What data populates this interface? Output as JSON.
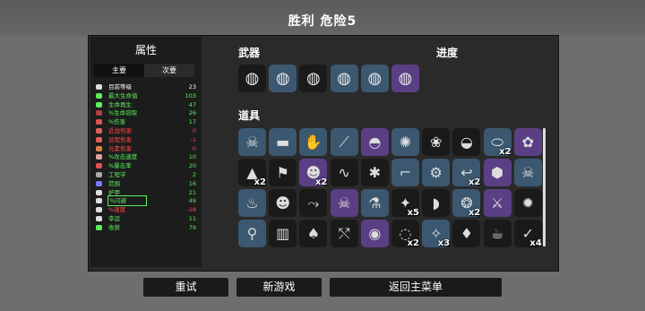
{
  "header": {
    "title": "胜利  危险5"
  },
  "stats_panel": {
    "title": "属性",
    "tabs": [
      {
        "label": "主要"
      },
      {
        "label": "次要"
      }
    ],
    "items": [
      {
        "label": "目前等级",
        "value": "23",
        "label_color": "#ffffff",
        "value_color": "#ffffff",
        "icon": "level-icon",
        "icon_color": "#dddddd"
      },
      {
        "label": "最大生命值",
        "value": "103",
        "label_color": "#5cf05c",
        "value_color": "#5cf05c",
        "icon": "heart-icon",
        "icon_color": "#5cf05c"
      },
      {
        "label": "生命再生",
        "value": "47",
        "label_color": "#5cf05c",
        "value_color": "#5cf05c",
        "icon": "regen-icon",
        "icon_color": "#5cf05c"
      },
      {
        "label": "%生命窃取",
        "value": "26",
        "label_color": "#5cf05c",
        "value_color": "#5cf05c",
        "icon": "lifesteal-icon",
        "icon_color": "#b04040"
      },
      {
        "label": "%伤害",
        "value": "17",
        "label_color": "#5cf05c",
        "value_color": "#5cf05c",
        "icon": "damage-icon",
        "icon_color": "#e05050"
      },
      {
        "label": "近战伤害",
        "value": "0",
        "label_color": "#ff4848",
        "value_color": "#ff4848",
        "icon": "melee-icon",
        "icon_color": "#e06060"
      },
      {
        "label": "远程伤害",
        "value": "-1",
        "label_color": "#ff4848",
        "value_color": "#ff4848",
        "icon": "ranged-icon",
        "icon_color": "#e06060"
      },
      {
        "label": "元素伤害",
        "value": "0",
        "label_color": "#ff4848",
        "value_color": "#ff4848",
        "icon": "elemental-icon",
        "icon_color": "#e08040"
      },
      {
        "label": "%攻击速度",
        "value": "10",
        "label_color": "#5cf05c",
        "value_color": "#5cf05c",
        "icon": "attack-speed-icon",
        "icon_color": "#e0a0a0"
      },
      {
        "label": "%暴击率",
        "value": "20",
        "label_color": "#5cf05c",
        "value_color": "#5cf05c",
        "icon": "crit-icon",
        "icon_color": "#e05050"
      },
      {
        "label": "工程学",
        "value": "2",
        "label_color": "#5cf05c",
        "value_color": "#5cf05c",
        "icon": "engineering-icon",
        "icon_color": "#aaaaaa"
      },
      {
        "label": "范围",
        "value": "16",
        "label_color": "#5cf05c",
        "value_color": "#5cf05c",
        "icon": "range-icon",
        "icon_color": "#7a7aff"
      },
      {
        "label": "护甲",
        "value": "21",
        "label_color": "#5cf05c",
        "value_color": "#5cf05c",
        "icon": "armor-icon",
        "icon_color": "#dddddd"
      },
      {
        "label": "%闪避",
        "value": "49",
        "label_color": "#5cf05c",
        "value_color": "#5cf05c",
        "icon": "dodge-icon",
        "icon_color": "#dddddd",
        "selected": true
      },
      {
        "label": "%速度",
        "value": "-18",
        "label_color": "#ff4848",
        "value_color": "#ff4848",
        "icon": "speed-icon",
        "icon_color": "#dddddd"
      },
      {
        "label": "幸运",
        "value": "11",
        "label_color": "#5cf05c",
        "value_color": "#5cf05c",
        "icon": "luck-icon",
        "icon_color": "#dddddd"
      },
      {
        "label": "收获",
        "value": "79",
        "label_color": "#5cf05c",
        "value_color": "#5cf05c",
        "icon": "harvest-icon",
        "icon_color": "#5cf05c"
      }
    ]
  },
  "weapons": {
    "title": "武器",
    "slots": [
      {
        "icon": "shield-weapon-icon",
        "glyph": "◍",
        "tier": "tier1"
      },
      {
        "icon": "shield-weapon-icon",
        "glyph": "◍",
        "tier": "tier2"
      },
      {
        "icon": "shield-weapon-icon",
        "glyph": "◍",
        "tier": "tier1"
      },
      {
        "icon": "shield-weapon-icon",
        "glyph": "◍",
        "tier": "tier2"
      },
      {
        "icon": "shield-weapon-icon",
        "glyph": "◍",
        "tier": "tier2"
      },
      {
        "icon": "shield-weapon-icon",
        "glyph": "◍",
        "tier": "tier3"
      }
    ]
  },
  "progress": {
    "title": "进度"
  },
  "items": {
    "title": "道具",
    "slots": [
      {
        "icon": "skull-mask-icon",
        "glyph": "☠",
        "tier": "tier2",
        "qty": ""
      },
      {
        "icon": "scarf-icon",
        "glyph": "▬",
        "tier": "tier2",
        "qty": ""
      },
      {
        "icon": "glove-icon",
        "glyph": "✋",
        "tier": "tier2",
        "qty": ""
      },
      {
        "icon": "bandage-icon",
        "glyph": "⟋",
        "tier": "tier2",
        "qty": ""
      },
      {
        "icon": "helmet-icon",
        "glyph": "◓",
        "tier": "tier3",
        "qty": ""
      },
      {
        "icon": "bee-icon",
        "glyph": "✺",
        "tier": "tier2",
        "qty": ""
      },
      {
        "icon": "red-flower-icon",
        "glyph": "❀",
        "tier": "tier1",
        "qty": ""
      },
      {
        "icon": "metal-helmet-icon",
        "glyph": "◒",
        "tier": "tier1",
        "qty": ""
      },
      {
        "icon": "grenade-icon",
        "glyph": "⬭",
        "tier": "tier2",
        "qty": "x2"
      },
      {
        "icon": "tooth-icon",
        "glyph": "✿",
        "tier": "tier3",
        "qty": ""
      },
      {
        "icon": "witch-hat-icon",
        "glyph": "▲",
        "tier": "tier1",
        "qty": "x2"
      },
      {
        "icon": "flag-icon",
        "glyph": "⚑",
        "tier": "tier1",
        "qty": ""
      },
      {
        "icon": "alien-icon",
        "glyph": "☻",
        "tier": "tier3",
        "qty": "x2"
      },
      {
        "icon": "scorpion-icon",
        "glyph": "∿",
        "tier": "tier1",
        "qty": ""
      },
      {
        "icon": "dynamite-icon",
        "glyph": "✱",
        "tier": "tier1",
        "qty": ""
      },
      {
        "icon": "pipe-icon",
        "glyph": "⌐",
        "tier": "tier2",
        "qty": ""
      },
      {
        "icon": "robot-icon",
        "glyph": "⚙",
        "tier": "tier2",
        "qty": ""
      },
      {
        "icon": "hook-icon",
        "glyph": "↩",
        "tier": "tier2",
        "qty": "x2"
      },
      {
        "icon": "gas-tank-icon",
        "glyph": "⬢",
        "tier": "tier3",
        "qty": ""
      },
      {
        "icon": "skull-ghost-icon",
        "glyph": "☠",
        "tier": "tier2",
        "qty": ""
      },
      {
        "icon": "campfire-icon",
        "glyph": "♨",
        "tier": "tier2",
        "qty": ""
      },
      {
        "icon": "red-monster-icon",
        "glyph": "☻",
        "tier": "tier1",
        "qty": ""
      },
      {
        "icon": "fish-bone-icon",
        "glyph": "⤳",
        "tier": "tier1",
        "qty": ""
      },
      {
        "icon": "bone-pile-icon",
        "glyph": "☠",
        "tier": "tier3",
        "qty": ""
      },
      {
        "icon": "potion-icon",
        "glyph": "⚗",
        "tier": "tier2",
        "qty": ""
      },
      {
        "icon": "crystal-icon",
        "glyph": "✦",
        "tier": "tier1",
        "qty": "x5"
      },
      {
        "icon": "dark-helmet-icon",
        "glyph": "◗",
        "tier": "tier1",
        "qty": ""
      },
      {
        "icon": "blue-creature-icon",
        "glyph": "❂",
        "tier": "tier2",
        "qty": "x2"
      },
      {
        "icon": "blood-slash-icon",
        "glyph": "⚔",
        "tier": "tier3",
        "qty": ""
      },
      {
        "icon": "spider-skull-icon",
        "glyph": "✹",
        "tier": "tier1",
        "qty": ""
      },
      {
        "icon": "green-drop-icon",
        "glyph": "⚲",
        "tier": "tier2",
        "qty": ""
      },
      {
        "icon": "jar-icon",
        "glyph": "▥",
        "tier": "tier1",
        "qty": ""
      },
      {
        "icon": "hot-sauce-icon",
        "glyph": "♠",
        "tier": "tier1",
        "qty": ""
      },
      {
        "icon": "blood-bone-icon",
        "glyph": "⤲",
        "tier": "tier1",
        "qty": ""
      },
      {
        "icon": "cauldron-icon",
        "glyph": "◉",
        "tier": "tier3",
        "qty": ""
      },
      {
        "icon": "bracelet-icon",
        "glyph": "◌",
        "tier": "tier1",
        "qty": "x2"
      },
      {
        "icon": "blue-bat-icon",
        "glyph": "✧",
        "tier": "tier2",
        "qty": "x3"
      },
      {
        "icon": "feather-icon",
        "glyph": "♦",
        "tier": "tier1",
        "qty": ""
      },
      {
        "icon": "tea-cup-icon",
        "glyph": "☕",
        "tier": "tier1",
        "qty": ""
      },
      {
        "icon": "sprout-icon",
        "glyph": "✓",
        "tier": "tier1",
        "qty": "x4"
      }
    ]
  },
  "buttons": [
    {
      "label": "重试"
    },
    {
      "label": "新游戏"
    },
    {
      "label": "返回主菜单"
    }
  ]
}
